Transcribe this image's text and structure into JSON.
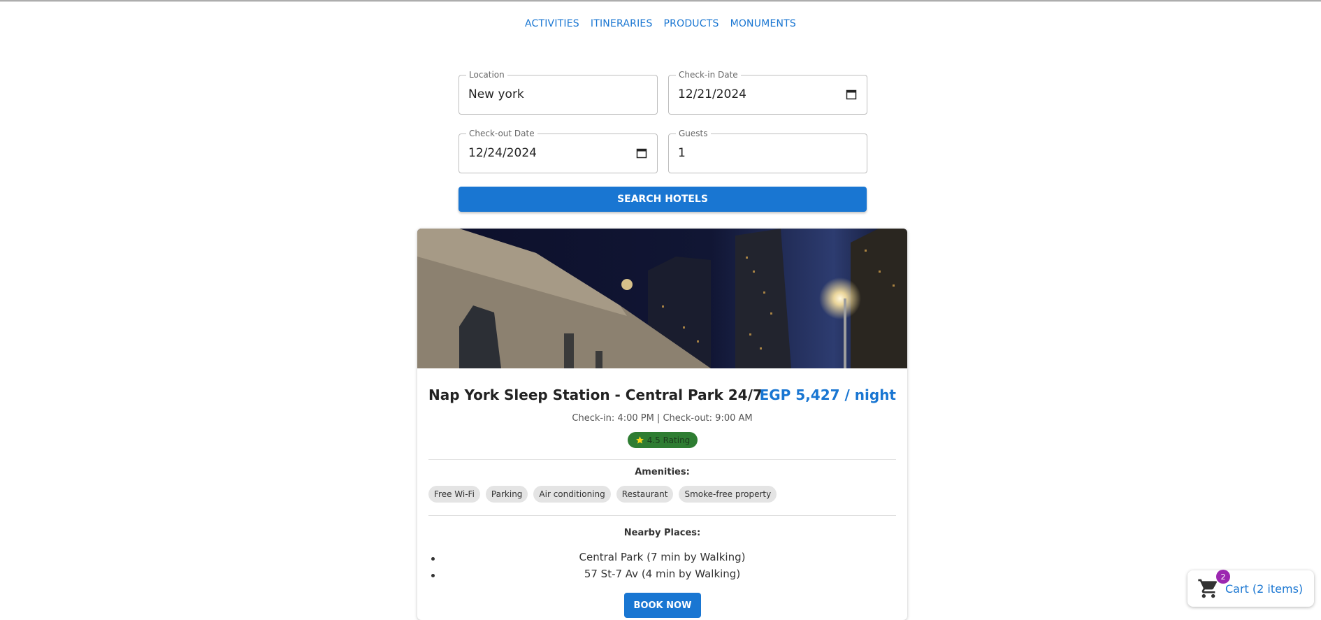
{
  "nav": {
    "items": [
      "ACTIVITIES",
      "ITINERARIES",
      "PRODUCTS",
      "MONUMENTS"
    ]
  },
  "search": {
    "location": {
      "label": "Location",
      "value": "New york"
    },
    "checkin": {
      "label": "Check-in Date",
      "value": "12/21/2024"
    },
    "checkout": {
      "label": "Check-out Date",
      "value": "12/24/2024"
    },
    "guests": {
      "label": "Guests",
      "value": "1"
    },
    "button_label": "SEARCH HOTELS"
  },
  "hotel": {
    "name": "Nap York Sleep Station - Central Park 24/7",
    "price": "EGP 5,427 / night",
    "times": "Check-in: 4:00 PM | Check-out: 9:00 AM",
    "rating_label": "4.5 Rating",
    "amenities_title": "Amenities:",
    "amenities": [
      "Free Wi-Fi",
      "Parking",
      "Air conditioning",
      "Restaurant",
      "Smoke-free property"
    ],
    "nearby_title": "Nearby Places:",
    "nearby": [
      "Central Park (7 min by Walking)",
      "57 St-7 Av (4 min by Walking)"
    ],
    "book_label": "BOOK NOW"
  },
  "cart": {
    "count": "2",
    "label": "Cart (2 items)"
  },
  "colors": {
    "accent": "#1976d2",
    "rating": "#2e7d32",
    "badge": "#9c27b0"
  }
}
